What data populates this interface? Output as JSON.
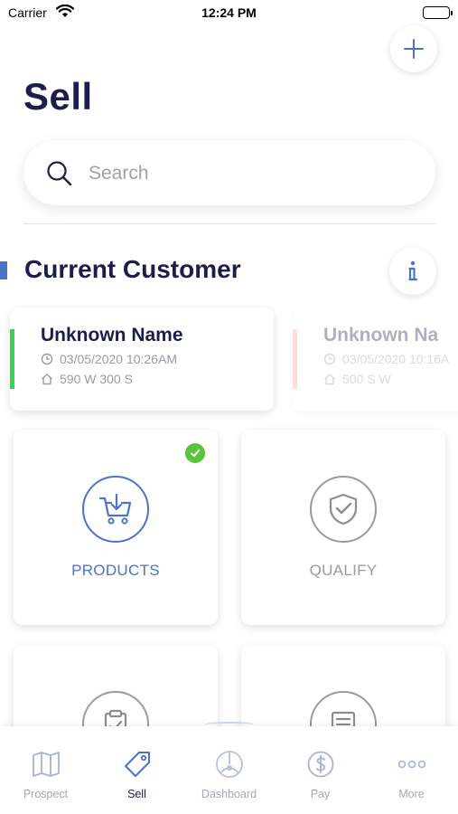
{
  "status_bar": {
    "carrier": "Carrier",
    "time": "12:24 PM"
  },
  "header": {
    "title": "Sell",
    "add_icon": "plus-icon"
  },
  "search": {
    "placeholder": "Search"
  },
  "section": {
    "title": "Current Customer",
    "info_icon": "info-icon"
  },
  "customers": [
    {
      "name": "Unknown Name",
      "datetime": "03/05/2020 10:26AM",
      "address": "590 W 300 S",
      "accent": "#39d353"
    },
    {
      "name": "Unknown Na",
      "datetime": "03/05/2020 10:16A",
      "address": "500 S W",
      "accent": "#f4a0ad"
    }
  ],
  "tiles": [
    {
      "label": "PRODUCTS",
      "icon": "cart-download-icon",
      "completed": true,
      "accent": "#4b73c6"
    },
    {
      "label": "QUALIFY",
      "icon": "shield-check-icon",
      "completed": false
    },
    {
      "label": "",
      "icon": "clipboard-icon",
      "completed": false
    },
    {
      "label": "",
      "icon": "document-icon",
      "completed": false
    }
  ],
  "tab_bar": {
    "active": "Sell",
    "items": [
      {
        "label": "Prospect",
        "icon": "map-icon"
      },
      {
        "label": "Sell",
        "icon": "tag-icon"
      },
      {
        "label": "Dashboard",
        "icon": "dashboard-icon"
      },
      {
        "label": "Pay",
        "icon": "dollar-circle-icon"
      },
      {
        "label": "More",
        "icon": "more-icon"
      }
    ]
  },
  "colors": {
    "primary": "#4b73c6",
    "title": "#1b1d4a",
    "muted": "#9a9a9a",
    "success": "#5ac43a"
  }
}
